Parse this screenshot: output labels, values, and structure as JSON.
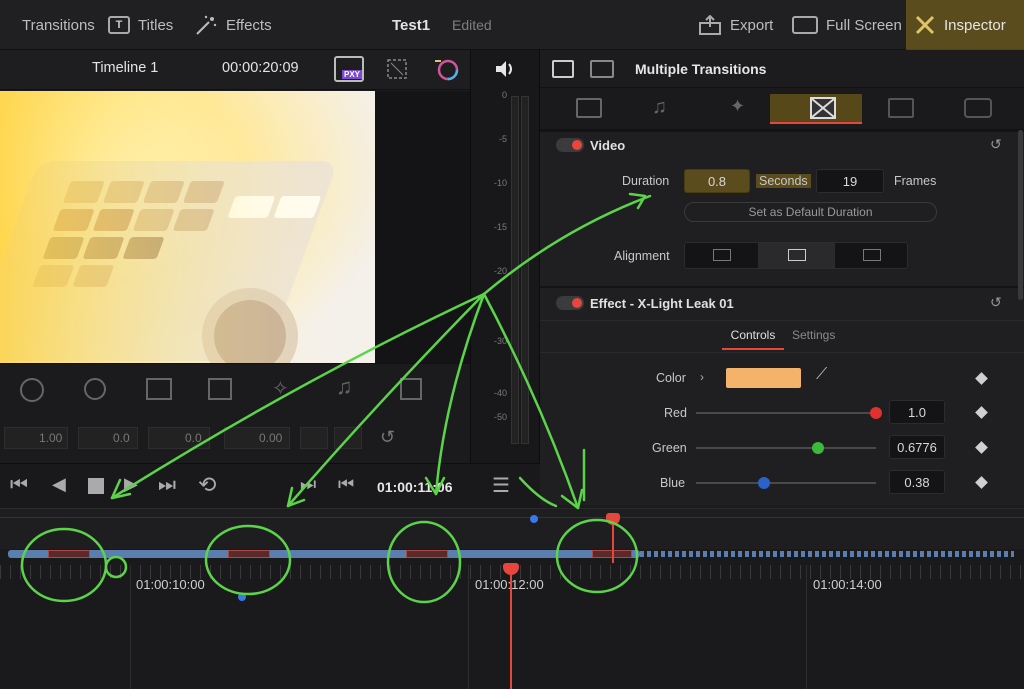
{
  "topbar": {
    "transitions": "Transitions",
    "titles": "Titles",
    "effects": "Effects",
    "project_name": "Test1",
    "edited_status": "Edited",
    "export": "Export",
    "fullscreen": "Full Screen",
    "inspector": "Inspector"
  },
  "viewer": {
    "timeline_name": "Timeline 1",
    "timecode": "00:00:20:09",
    "proxy_badge": "PXY"
  },
  "meters": {
    "ticks": [
      "0",
      "-5",
      "-10",
      "-15",
      "-20",
      "-30",
      "-40",
      "-50"
    ]
  },
  "inspector": {
    "title": "Multiple Transitions",
    "video_section": "Video",
    "duration_label": "Duration",
    "duration_value": "0.8",
    "seconds_label": "Seconds",
    "frames_value": "19",
    "frames_label": "Frames",
    "default_duration_button": "Set as Default Duration",
    "alignment_label": "Alignment",
    "effect_section": "Effect - X-Light Leak 01",
    "tab_controls": "Controls",
    "tab_settings": "Settings",
    "color_label": "Color",
    "swatch_color": "#f4b36a",
    "red_label": "Red",
    "red_value": "1.0",
    "red_level": 1.0,
    "green_label": "Green",
    "green_value": "0.6776",
    "green_level": 0.6776,
    "blue_label": "Blue",
    "blue_value": "0.38",
    "blue_level": 0.38
  },
  "transform": {
    "zoom": "1.00",
    "position": "0.0",
    "tilt": "0.0",
    "rotation": "0.00"
  },
  "transport": {
    "timecode": "01:00:11:06"
  },
  "timeline": {
    "ruler_labels": [
      "01:00:10:00",
      "01:00:12:00",
      "01:00:14:00"
    ]
  },
  "colors": {
    "accent_red": "#e8463c",
    "clip_blue": "#5a7fae",
    "annotation_green": "#5cd44a",
    "inspector_highlight": "#c9a21a"
  }
}
